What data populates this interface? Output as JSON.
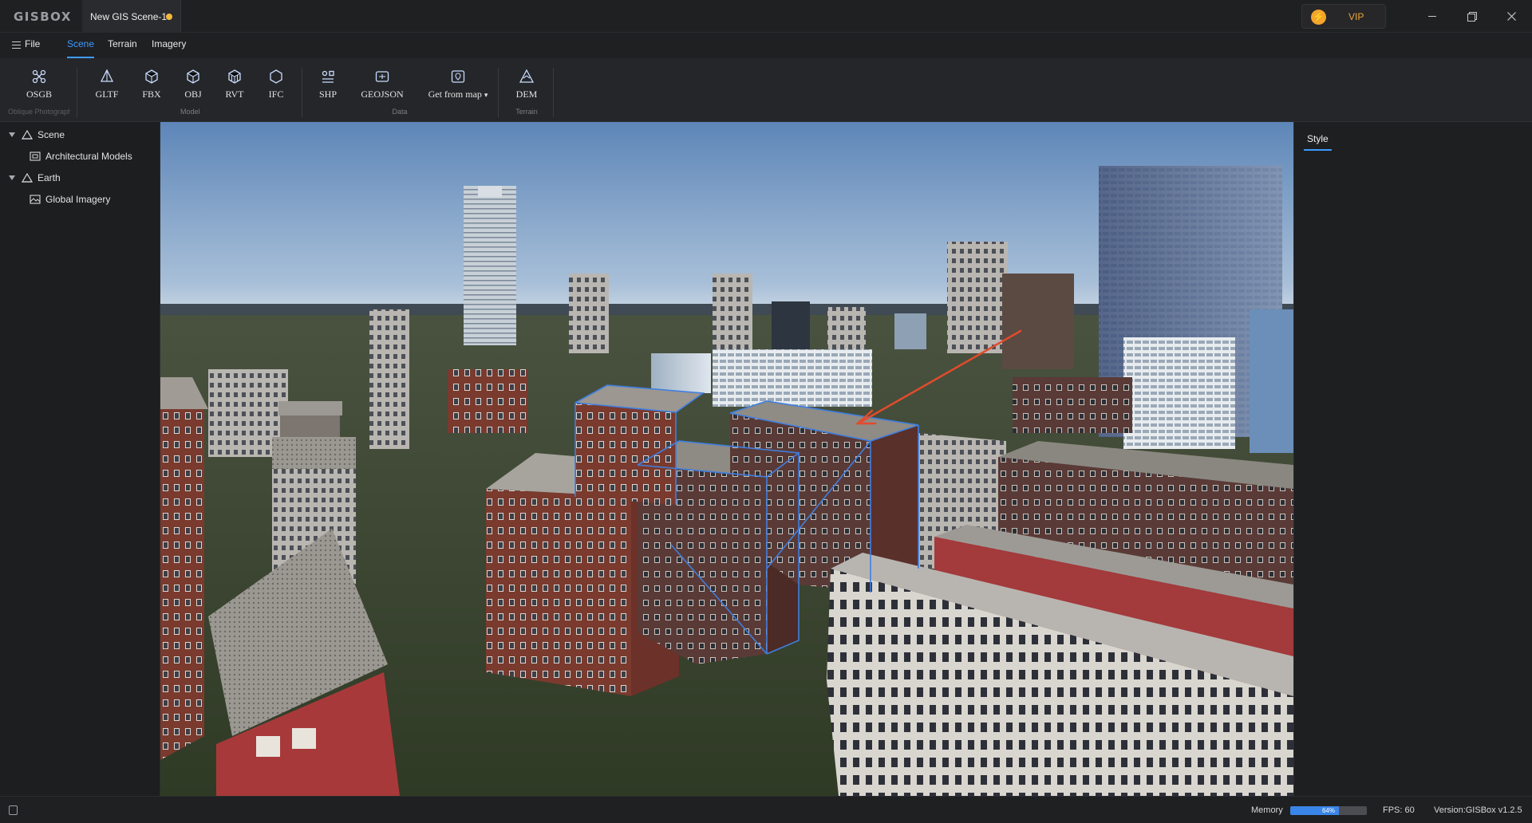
{
  "app": {
    "logo": "GISBOX",
    "document_tab": "New GIS Scene-1",
    "vip_label": "VIP"
  },
  "menu": {
    "file": "File",
    "tabs": [
      {
        "label": "Scene",
        "active": true
      },
      {
        "label": "Terrain",
        "active": false
      },
      {
        "label": "Imagery",
        "active": false
      }
    ]
  },
  "toolbar": {
    "osgb": "OSGB",
    "osgb_group": "Oblique Photography",
    "gltf": "GLTF",
    "fbx": "FBX",
    "obj": "OBJ",
    "rvt": "RVT",
    "ifc": "IFC",
    "model_group": "Model",
    "shp": "SHP",
    "geojson": "GEOJSON",
    "get_from_map": "Get from map",
    "data_group": "Data",
    "dem": "DEM",
    "terrain_group": "Terrain"
  },
  "tree": {
    "scene": "Scene",
    "architectural_models": "Architectural Models",
    "earth": "Earth",
    "global_imagery": "Global Imagery"
  },
  "right_panel": {
    "style_tab": "Style"
  },
  "status": {
    "memory_label": "Memory",
    "memory_percent": 64,
    "memory_text": "64%",
    "fps": "FPS: 60",
    "version": "Version:GISBox v1.2.5"
  },
  "colors": {
    "accent": "#3e9bff",
    "vip": "#e9a53a",
    "memory_bar": "#3a86e8"
  }
}
